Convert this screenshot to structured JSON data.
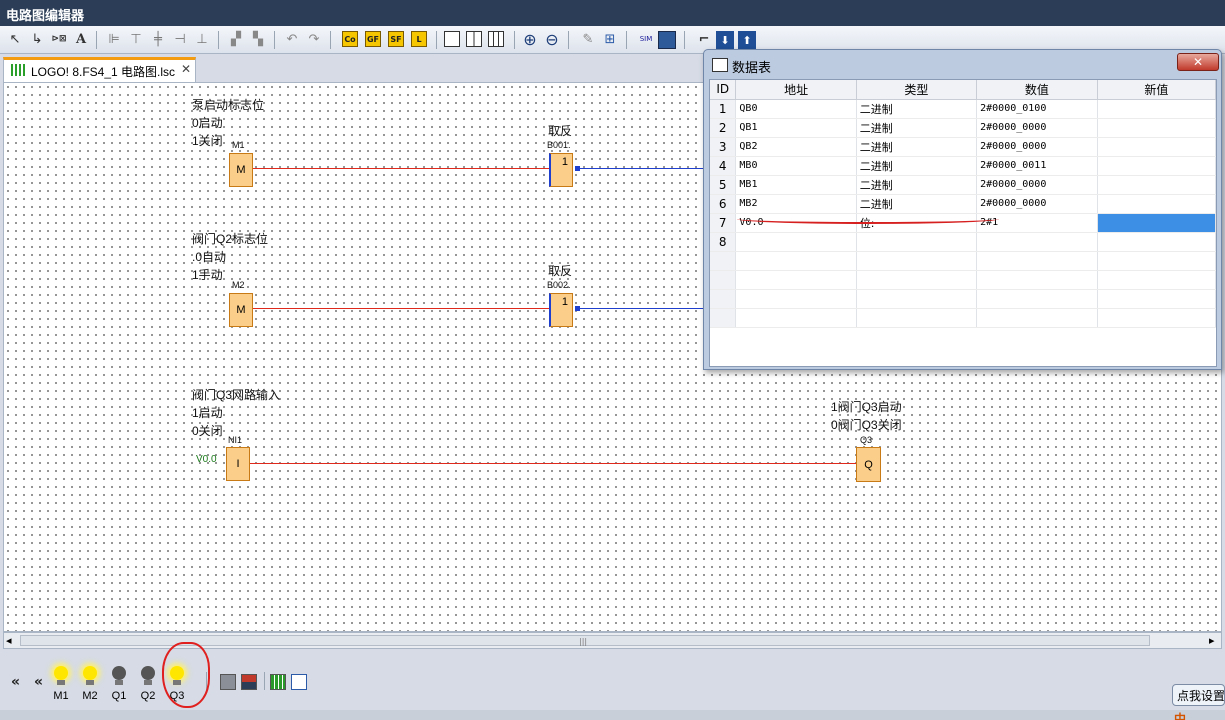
{
  "app": {
    "title": "电路图编辑器"
  },
  "tab": {
    "label": "LOGO! 8.FS4_1 电路图.lsc",
    "close": "✕"
  },
  "toolbar": {
    "select_icon": "↖",
    "connect_icon": "↳",
    "text_icon": "A",
    "co_label": "Co",
    "gf_label": "GF",
    "sf_label": "SF",
    "l_label": "L",
    "undo_icon": "↶",
    "redo_icon": "↷",
    "zoom_in_icon": "⊕",
    "zoom_out_icon": "⊖",
    "sim_label": "SIM"
  },
  "circuit": {
    "rung1": {
      "comment1": "泵启动标志位",
      "comment2": "0启动",
      "comment3": "1关闭",
      "block_name": "M1",
      "block_text": "M",
      "not_title": "取反",
      "not_name": "B001.",
      "not_text": "1"
    },
    "rung2": {
      "comment1": "阀门Q2标志位",
      "comment2": ".0自动",
      "comment3": "1手动",
      "block_name": "M2",
      "block_text": "M",
      "not_title": "取反",
      "not_name": "B002.",
      "not_text": "1"
    },
    "rung3": {
      "comment1": "阀门Q3网路输入",
      "comment2": "1启动",
      "comment3": "0关闭",
      "block_name": "NI1",
      "input_addr": "V0.0",
      "block_text": "I",
      "out_comment1": "1阀门Q3启动",
      "out_comment2": "0阀门Q3关闭",
      "out_name": "Q3",
      "out_text": "Q"
    }
  },
  "scrollbar": {
    "left_arrow": "◂",
    "grip": "|||",
    "right_arrow": "▸"
  },
  "simulation": {
    "collapse1": "«",
    "collapse2": "«",
    "lamps": [
      {
        "name": "M1",
        "on": true
      },
      {
        "name": "M2",
        "on": true
      },
      {
        "name": "Q1",
        "on": false
      },
      {
        "name": "Q2",
        "on": false
      },
      {
        "name": "Q3",
        "on": true
      }
    ]
  },
  "data_table": {
    "title": "数据表",
    "close": "✕",
    "headers": [
      "ID",
      "地址",
      "类型",
      "数值",
      "新值"
    ],
    "rows": [
      {
        "id": "1",
        "address": "QB0",
        "type": "二进制",
        "value": "2#0000_0100",
        "new": ""
      },
      {
        "id": "2",
        "address": "QB1",
        "type": "二进制",
        "value": "2#0000_0000",
        "new": ""
      },
      {
        "id": "3",
        "address": "QB2",
        "type": "二进制",
        "value": "2#0000_0000",
        "new": ""
      },
      {
        "id": "4",
        "address": "MB0",
        "type": "二进制",
        "value": "2#0000_0011",
        "new": ""
      },
      {
        "id": "5",
        "address": "MB1",
        "type": "二进制",
        "value": "2#0000_0000",
        "new": ""
      },
      {
        "id": "6",
        "address": "MB2",
        "type": "二进制",
        "value": "2#0000_0000",
        "new": ""
      },
      {
        "id": "7",
        "address": "V0.0",
        "type": "位:",
        "value": "2#1",
        "new": ""
      },
      {
        "id": "8",
        "address": "",
        "type": "",
        "value": "",
        "new": ""
      }
    ]
  },
  "hint": {
    "text": "点我设置",
    "tail": "中"
  }
}
